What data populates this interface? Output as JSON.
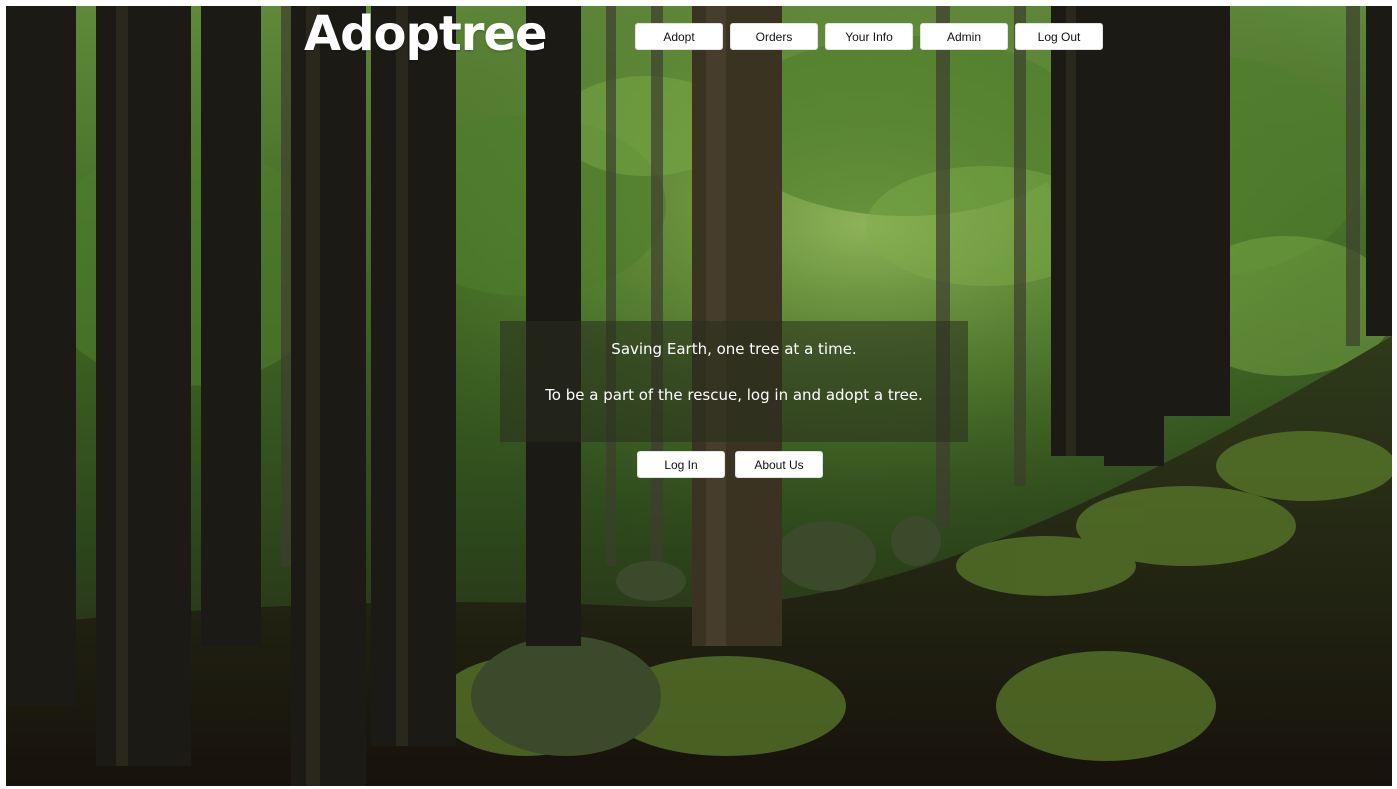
{
  "app": {
    "logo": "Adoptree"
  },
  "nav": {
    "items": [
      {
        "label": "Adopt"
      },
      {
        "label": "Orders"
      },
      {
        "label": "Your Info"
      },
      {
        "label": "Admin"
      },
      {
        "label": "Log Out"
      }
    ]
  },
  "hero": {
    "headline": "Saving Earth, one tree at a time.",
    "subtext": "To be a part of the rescue, log in and adopt a tree."
  },
  "actions": {
    "login_label": "Log In",
    "about_label": "About Us"
  },
  "colors": {
    "button_bg": "#ffffff",
    "logo_text": "#ffffff",
    "hero_overlay": "rgba(40,45,30,0.55)"
  }
}
